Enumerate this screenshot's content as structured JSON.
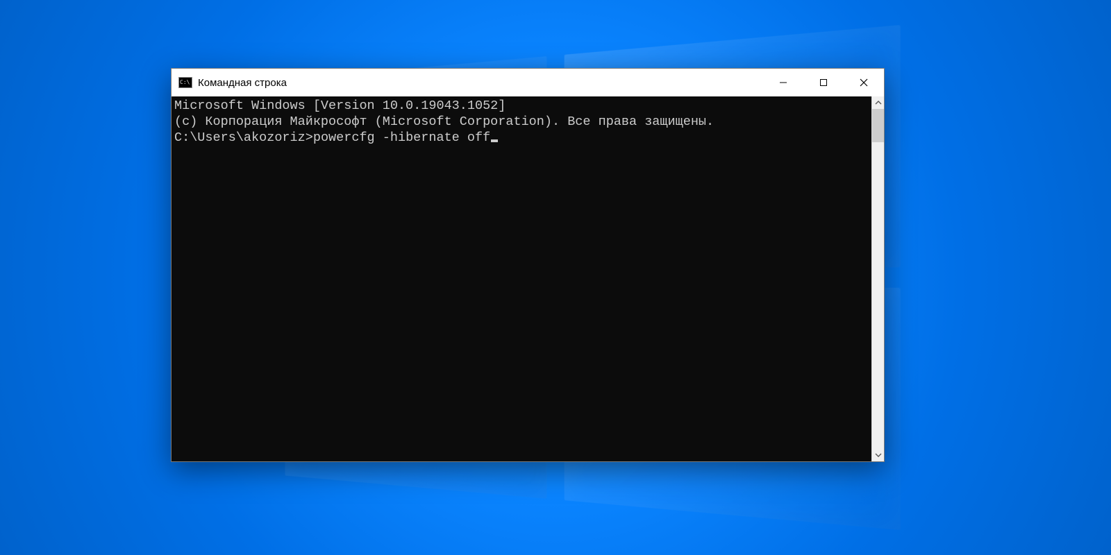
{
  "window": {
    "title": "Командная строка"
  },
  "terminal": {
    "line1": "Microsoft Windows [Version 10.0.19043.1052]",
    "line2": "(c) Корпорация Майкрософт (Microsoft Corporation). Все права защищены.",
    "blank": "",
    "prompt": "C:\\Users\\akozoriz>",
    "command": "powercfg -hibernate off"
  },
  "colors": {
    "terminal_bg": "#0c0c0c",
    "terminal_fg": "#cccccc",
    "desktop_accent": "#0a84ff"
  }
}
